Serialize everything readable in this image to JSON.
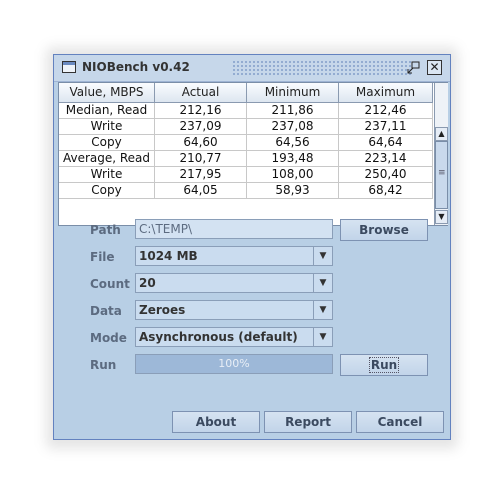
{
  "window": {
    "title": "NIOBench v0.42",
    "restore_icon": "restore-icon",
    "close_icon": "close-icon",
    "close_glyph": "☒"
  },
  "table": {
    "columns": [
      "Value, MBPS",
      "Actual",
      "Minimum",
      "Maximum"
    ],
    "rows": [
      [
        "Median, Read",
        "212,16",
        "211,86",
        "212,46"
      ],
      [
        "Write",
        "237,09",
        "237,08",
        "237,11"
      ],
      [
        "Copy",
        "64,60",
        "64,56",
        "64,64"
      ],
      [
        "Average, Read",
        "210,77",
        "193,48",
        "223,14"
      ],
      [
        "Write",
        "217,95",
        "108,00",
        "250,40"
      ],
      [
        "Copy",
        "64,05",
        "58,93",
        "68,42"
      ]
    ]
  },
  "form": {
    "path_label": "Path",
    "path_value": "C:\\TEMP\\",
    "browse_label": "Browse",
    "file_label": "File",
    "file_value": "1024 MB",
    "count_label": "Count",
    "count_value": "20",
    "data_label": "Data",
    "data_value": "Zeroes",
    "mode_label": "Mode",
    "mode_value": "Asynchronous (default)",
    "run_label": "Run",
    "progress_text": "100%",
    "progress_fraction": 1.0,
    "run_button_label": "Run"
  },
  "footer": {
    "about_label": "About",
    "report_label": "Report",
    "cancel_label": "Cancel"
  }
}
